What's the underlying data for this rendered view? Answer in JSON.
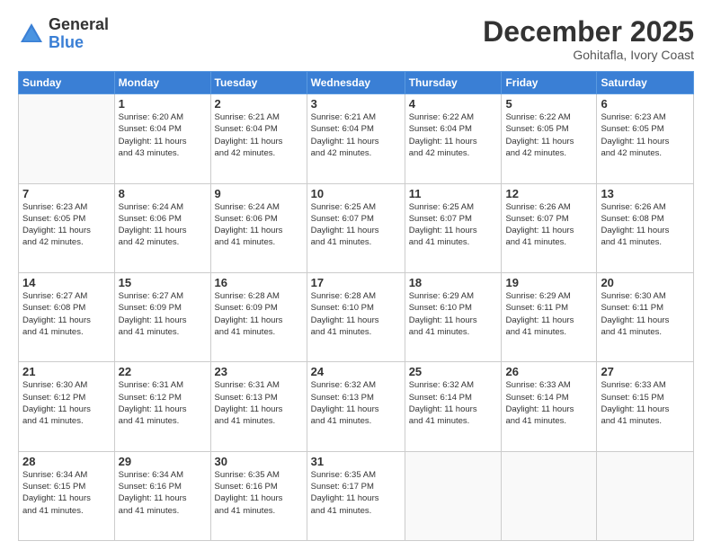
{
  "logo": {
    "general": "General",
    "blue": "Blue"
  },
  "title": "December 2025",
  "subtitle": "Gohitafla, Ivory Coast",
  "days_of_week": [
    "Sunday",
    "Monday",
    "Tuesday",
    "Wednesday",
    "Thursday",
    "Friday",
    "Saturday"
  ],
  "weeks": [
    [
      {
        "day": "",
        "info": ""
      },
      {
        "day": "1",
        "info": "Sunrise: 6:20 AM\nSunset: 6:04 PM\nDaylight: 11 hours\nand 43 minutes."
      },
      {
        "day": "2",
        "info": "Sunrise: 6:21 AM\nSunset: 6:04 PM\nDaylight: 11 hours\nand 42 minutes."
      },
      {
        "day": "3",
        "info": "Sunrise: 6:21 AM\nSunset: 6:04 PM\nDaylight: 11 hours\nand 42 minutes."
      },
      {
        "day": "4",
        "info": "Sunrise: 6:22 AM\nSunset: 6:04 PM\nDaylight: 11 hours\nand 42 minutes."
      },
      {
        "day": "5",
        "info": "Sunrise: 6:22 AM\nSunset: 6:05 PM\nDaylight: 11 hours\nand 42 minutes."
      },
      {
        "day": "6",
        "info": "Sunrise: 6:23 AM\nSunset: 6:05 PM\nDaylight: 11 hours\nand 42 minutes."
      }
    ],
    [
      {
        "day": "7",
        "info": "Sunrise: 6:23 AM\nSunset: 6:05 PM\nDaylight: 11 hours\nand 42 minutes."
      },
      {
        "day": "8",
        "info": "Sunrise: 6:24 AM\nSunset: 6:06 PM\nDaylight: 11 hours\nand 42 minutes."
      },
      {
        "day": "9",
        "info": "Sunrise: 6:24 AM\nSunset: 6:06 PM\nDaylight: 11 hours\nand 41 minutes."
      },
      {
        "day": "10",
        "info": "Sunrise: 6:25 AM\nSunset: 6:07 PM\nDaylight: 11 hours\nand 41 minutes."
      },
      {
        "day": "11",
        "info": "Sunrise: 6:25 AM\nSunset: 6:07 PM\nDaylight: 11 hours\nand 41 minutes."
      },
      {
        "day": "12",
        "info": "Sunrise: 6:26 AM\nSunset: 6:07 PM\nDaylight: 11 hours\nand 41 minutes."
      },
      {
        "day": "13",
        "info": "Sunrise: 6:26 AM\nSunset: 6:08 PM\nDaylight: 11 hours\nand 41 minutes."
      }
    ],
    [
      {
        "day": "14",
        "info": "Sunrise: 6:27 AM\nSunset: 6:08 PM\nDaylight: 11 hours\nand 41 minutes."
      },
      {
        "day": "15",
        "info": "Sunrise: 6:27 AM\nSunset: 6:09 PM\nDaylight: 11 hours\nand 41 minutes."
      },
      {
        "day": "16",
        "info": "Sunrise: 6:28 AM\nSunset: 6:09 PM\nDaylight: 11 hours\nand 41 minutes."
      },
      {
        "day": "17",
        "info": "Sunrise: 6:28 AM\nSunset: 6:10 PM\nDaylight: 11 hours\nand 41 minutes."
      },
      {
        "day": "18",
        "info": "Sunrise: 6:29 AM\nSunset: 6:10 PM\nDaylight: 11 hours\nand 41 minutes."
      },
      {
        "day": "19",
        "info": "Sunrise: 6:29 AM\nSunset: 6:11 PM\nDaylight: 11 hours\nand 41 minutes."
      },
      {
        "day": "20",
        "info": "Sunrise: 6:30 AM\nSunset: 6:11 PM\nDaylight: 11 hours\nand 41 minutes."
      }
    ],
    [
      {
        "day": "21",
        "info": "Sunrise: 6:30 AM\nSunset: 6:12 PM\nDaylight: 11 hours\nand 41 minutes."
      },
      {
        "day": "22",
        "info": "Sunrise: 6:31 AM\nSunset: 6:12 PM\nDaylight: 11 hours\nand 41 minutes."
      },
      {
        "day": "23",
        "info": "Sunrise: 6:31 AM\nSunset: 6:13 PM\nDaylight: 11 hours\nand 41 minutes."
      },
      {
        "day": "24",
        "info": "Sunrise: 6:32 AM\nSunset: 6:13 PM\nDaylight: 11 hours\nand 41 minutes."
      },
      {
        "day": "25",
        "info": "Sunrise: 6:32 AM\nSunset: 6:14 PM\nDaylight: 11 hours\nand 41 minutes."
      },
      {
        "day": "26",
        "info": "Sunrise: 6:33 AM\nSunset: 6:14 PM\nDaylight: 11 hours\nand 41 minutes."
      },
      {
        "day": "27",
        "info": "Sunrise: 6:33 AM\nSunset: 6:15 PM\nDaylight: 11 hours\nand 41 minutes."
      }
    ],
    [
      {
        "day": "28",
        "info": "Sunrise: 6:34 AM\nSunset: 6:15 PM\nDaylight: 11 hours\nand 41 minutes."
      },
      {
        "day": "29",
        "info": "Sunrise: 6:34 AM\nSunset: 6:16 PM\nDaylight: 11 hours\nand 41 minutes."
      },
      {
        "day": "30",
        "info": "Sunrise: 6:35 AM\nSunset: 6:16 PM\nDaylight: 11 hours\nand 41 minutes."
      },
      {
        "day": "31",
        "info": "Sunrise: 6:35 AM\nSunset: 6:17 PM\nDaylight: 11 hours\nand 41 minutes."
      },
      {
        "day": "",
        "info": ""
      },
      {
        "day": "",
        "info": ""
      },
      {
        "day": "",
        "info": ""
      }
    ]
  ]
}
